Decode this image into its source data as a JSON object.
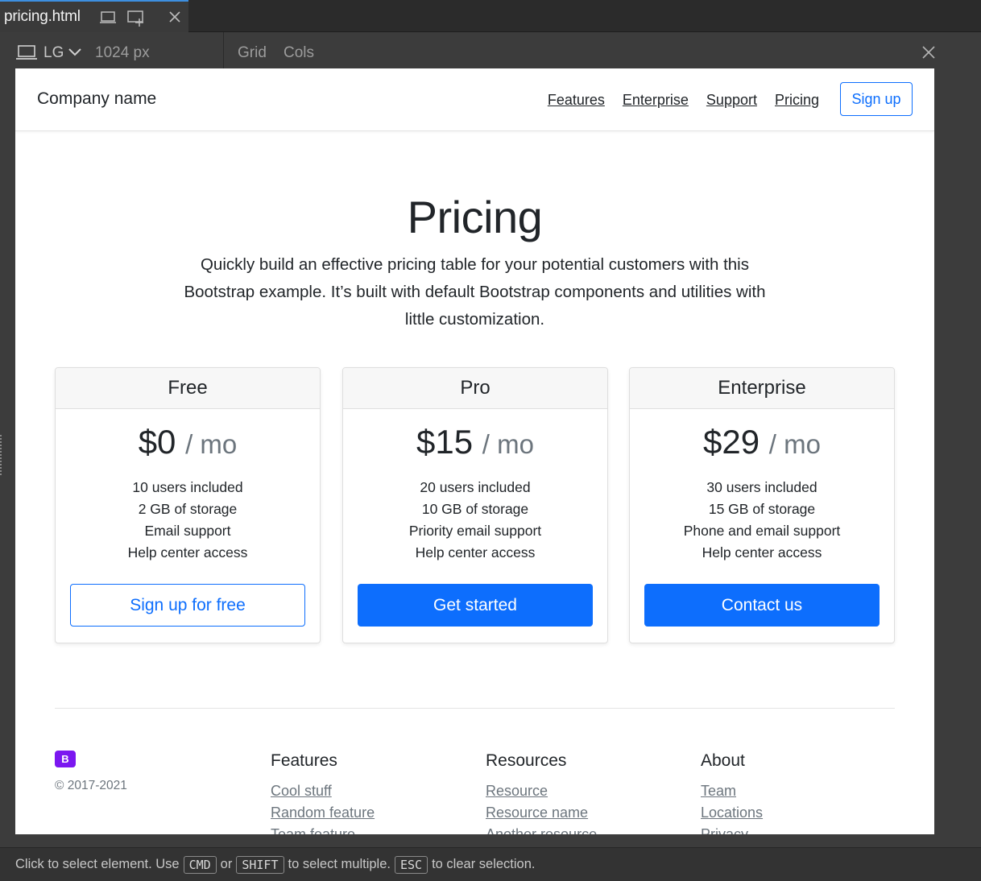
{
  "tab": {
    "title": "pricing.html"
  },
  "toolbar": {
    "device": "LG",
    "width": "1024 px",
    "grid": "Grid",
    "cols": "Cols"
  },
  "navbar": {
    "brand": "Company name",
    "links": [
      "Features",
      "Enterprise",
      "Support",
      "Pricing"
    ],
    "signup": "Sign up"
  },
  "hero": {
    "title": "Pricing",
    "lead": "Quickly build an effective pricing table for your potential customers with this Bootstrap example. It’s built with default Bootstrap components and utilities with little customization."
  },
  "plans": [
    {
      "name": "Free",
      "price": "$0",
      "period": "/ mo",
      "features": [
        "10 users included",
        "2 GB of storage",
        "Email support",
        "Help center access"
      ],
      "button": "Sign up for free"
    },
    {
      "name": "Pro",
      "price": "$15",
      "period": "/ mo",
      "features": [
        "20 users included",
        "10 GB of storage",
        "Priority email support",
        "Help center access"
      ],
      "button": "Get started"
    },
    {
      "name": "Enterprise",
      "price": "$29",
      "period": "/ mo",
      "features": [
        "30 users included",
        "15 GB of storage",
        "Phone and email support",
        "Help center access"
      ],
      "button": "Contact us"
    }
  ],
  "footer": {
    "logo": "B",
    "copyright": "© 2017-2021",
    "columns": [
      {
        "title": "Features",
        "links": [
          "Cool stuff",
          "Random feature",
          "Team feature"
        ]
      },
      {
        "title": "Resources",
        "links": [
          "Resource",
          "Resource name",
          "Another resource"
        ]
      },
      {
        "title": "About",
        "links": [
          "Team",
          "Locations",
          "Privacy"
        ]
      }
    ]
  },
  "status": {
    "text1": "Click to select element. Use",
    "key1": "CMD",
    "text2": "or",
    "key2": "SHIFT",
    "text3": "to select multiple.",
    "key3": "ESC",
    "text4": "to clear selection."
  },
  "colors": {
    "primary": "#0d6efd",
    "bootstrap_purple": "#7b17f0",
    "tab_accent": "#3d8fe0"
  }
}
